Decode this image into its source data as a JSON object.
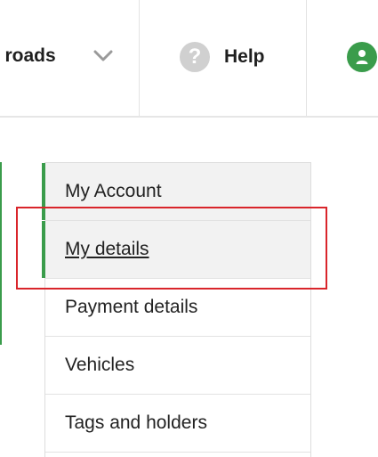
{
  "header": {
    "roads_label": "ll roads",
    "help_label": "Help",
    "help_icon_glyph": "?"
  },
  "nav": {
    "items": [
      {
        "label": "My Account"
      },
      {
        "label": "My details"
      },
      {
        "label": "Payment details"
      },
      {
        "label": "Vehicles"
      },
      {
        "label": "Tags and holders"
      }
    ]
  },
  "colors": {
    "accent": "#3a9c4b",
    "highlight": "#d9252b"
  }
}
